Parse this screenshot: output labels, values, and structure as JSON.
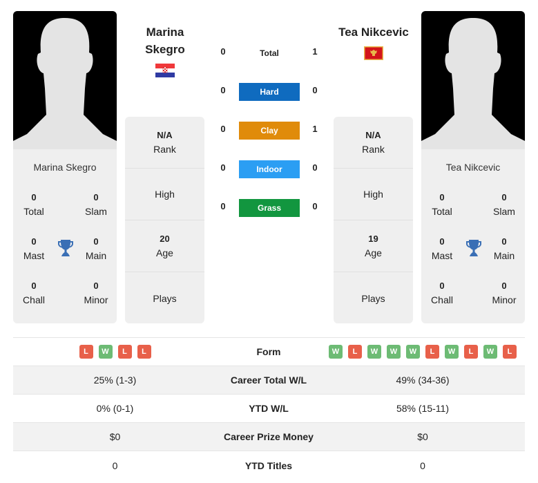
{
  "player1": {
    "name_line1": "Marina",
    "name_line2": "Skegro",
    "full_name": "Marina Skegro",
    "flag": "croatia-flag",
    "stats": {
      "total": {
        "value": "0",
        "label": "Total"
      },
      "slam": {
        "value": "0",
        "label": "Slam"
      },
      "mast": {
        "value": "0",
        "label": "Mast"
      },
      "main": {
        "value": "0",
        "label": "Main"
      },
      "chall": {
        "value": "0",
        "label": "Chall"
      },
      "minor": {
        "value": "0",
        "label": "Minor"
      }
    },
    "info": {
      "rank_value": "N/A",
      "rank_label": "Rank",
      "high_label": "High",
      "age_value": "20",
      "age_label": "Age",
      "plays_label": "Plays"
    }
  },
  "player2": {
    "name": "Tea Nikcevic",
    "full_name": "Tea Nikcevic",
    "flag": "montenegro-flag",
    "stats": {
      "total": {
        "value": "0",
        "label": "Total"
      },
      "slam": {
        "value": "0",
        "label": "Slam"
      },
      "mast": {
        "value": "0",
        "label": "Mast"
      },
      "main": {
        "value": "0",
        "label": "Main"
      },
      "chall": {
        "value": "0",
        "label": "Chall"
      },
      "minor": {
        "value": "0",
        "label": "Minor"
      }
    },
    "info": {
      "rank_value": "N/A",
      "rank_label": "Rank",
      "high_label": "High",
      "age_value": "19",
      "age_label": "Age",
      "plays_label": "Plays"
    }
  },
  "h2h": {
    "total": {
      "label": "Total",
      "p1": "0",
      "p2": "1"
    },
    "surfaces": [
      {
        "label": "Hard",
        "p1": "0",
        "p2": "0",
        "color": "#0f6bbf"
      },
      {
        "label": "Clay",
        "p1": "0",
        "p2": "1",
        "color": "#e08b0a"
      },
      {
        "label": "Indoor",
        "p1": "0",
        "p2": "0",
        "color": "#2b9ef3"
      },
      {
        "label": "Grass",
        "p1": "0",
        "p2": "0",
        "color": "#12963f"
      }
    ]
  },
  "comparison": {
    "form": {
      "label": "Form",
      "p1": [
        "L",
        "W",
        "L",
        "L"
      ],
      "p2": [
        "W",
        "L",
        "W",
        "W",
        "W",
        "L",
        "W",
        "L",
        "W",
        "L"
      ]
    },
    "rows": [
      {
        "label": "Career Total W/L",
        "p1": "25% (1-3)",
        "p2": "49% (34-36)"
      },
      {
        "label": "YTD W/L",
        "p1": "0% (0-1)",
        "p2": "58% (15-11)"
      },
      {
        "label": "Career Prize Money",
        "p1": "$0",
        "p2": "$0"
      },
      {
        "label": "YTD Titles",
        "p1": "0",
        "p2": "0"
      }
    ]
  },
  "colors": {
    "win": "#6dbb74",
    "loss": "#e8604a",
    "trophy": "#3a6fb5"
  }
}
